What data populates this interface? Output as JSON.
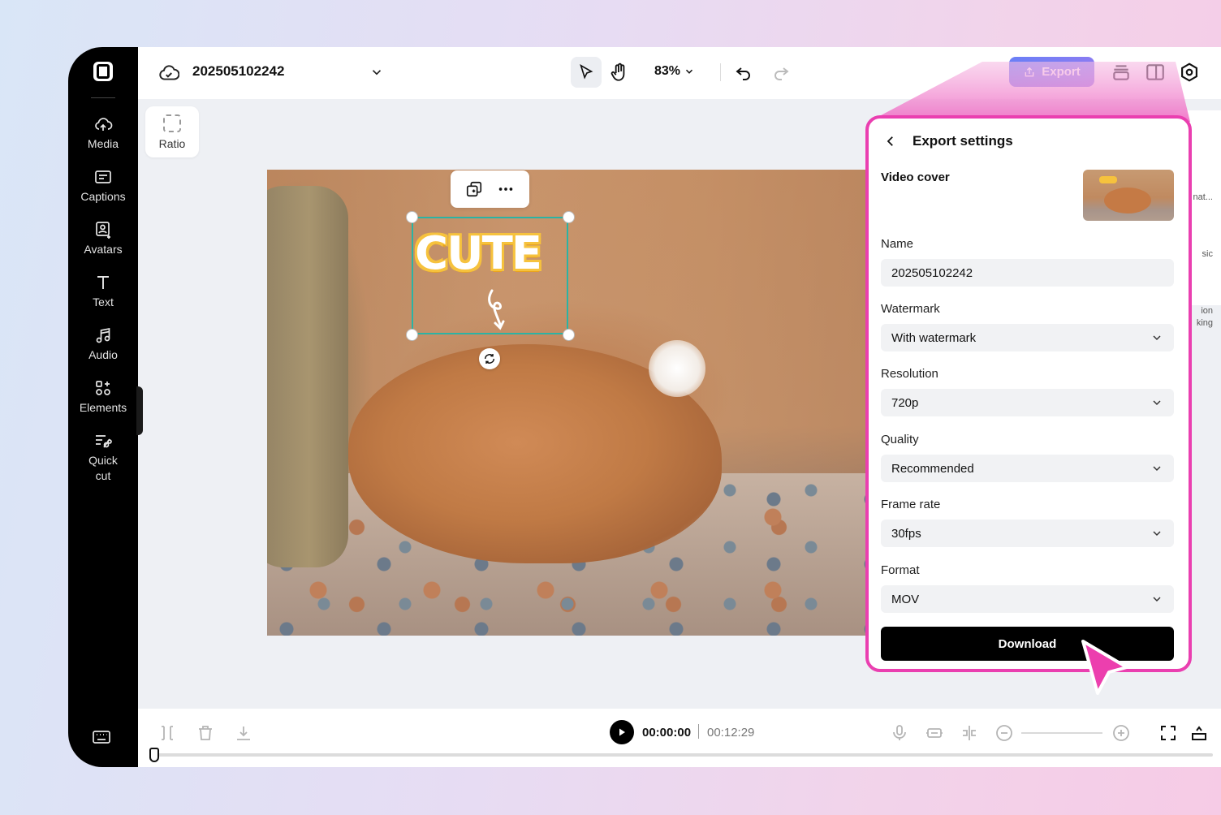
{
  "project": {
    "title": "202505102242"
  },
  "toolbar": {
    "zoom": "83%",
    "export_label": "Export"
  },
  "sidebar": {
    "items": [
      {
        "label": "Media",
        "icon": "cloud-upload-icon"
      },
      {
        "label": "Captions",
        "icon": "captions-icon"
      },
      {
        "label": "Avatars",
        "icon": "avatar-icon"
      },
      {
        "label": "Text",
        "icon": "text-icon"
      },
      {
        "label": "Audio",
        "icon": "music-note-icon"
      },
      {
        "label": "Elements",
        "icon": "elements-icon"
      },
      {
        "label": "Quick cut",
        "icon": "quick-cut-icon"
      }
    ]
  },
  "canvas": {
    "ratio_label": "Ratio",
    "sticker_text": "CUTE"
  },
  "right_tools": {
    "items": [
      "nat...",
      "sic",
      "ion",
      "king"
    ]
  },
  "export_panel": {
    "title": "Export settings",
    "video_cover_label": "Video cover",
    "name_label": "Name",
    "name_value": "202505102242",
    "watermark_label": "Watermark",
    "watermark_value": "With watermark",
    "resolution_label": "Resolution",
    "resolution_value": "720p",
    "quality_label": "Quality",
    "quality_value": "Recommended",
    "framerate_label": "Frame rate",
    "framerate_value": "30fps",
    "format_label": "Format",
    "format_value": "MOV",
    "download_label": "Download"
  },
  "timeline": {
    "current_time": "00:00:00",
    "total_time": "00:12:29"
  },
  "colors": {
    "accent_pink": "#ea3fb0",
    "export_blue": "#6a7ff6",
    "selection_teal": "#2bb3a4"
  }
}
